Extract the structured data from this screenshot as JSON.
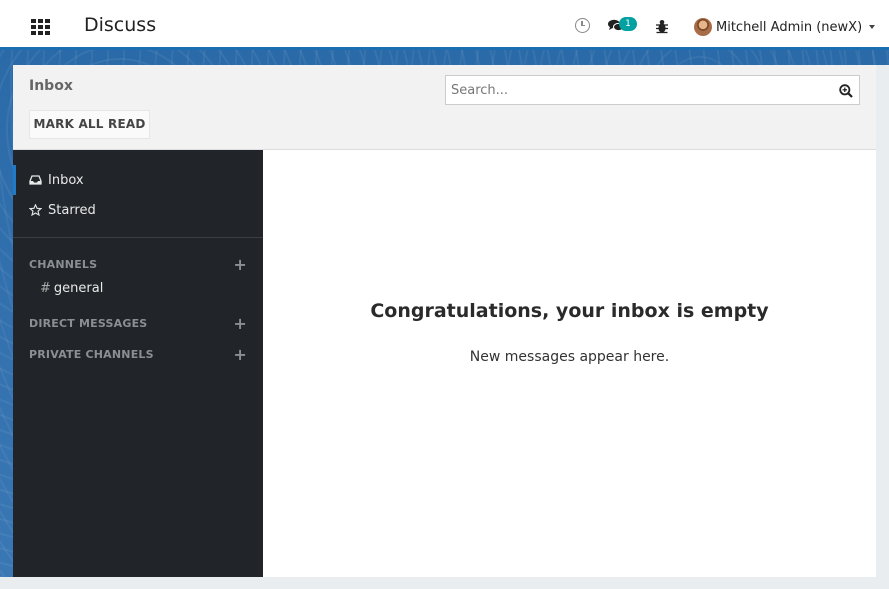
{
  "topbar": {
    "app_title": "Discuss",
    "apps_icon": "apps-grid-icon",
    "activity_icon": "clock-icon",
    "messaging_icon": "chat-icon",
    "messaging_badge": "1",
    "debug_icon": "bug-icon",
    "user_name": "Mitchell Admin (newX)"
  },
  "control_panel": {
    "breadcrumb": "Inbox",
    "mark_all_read": "MARK ALL READ",
    "search_placeholder": "Search..."
  },
  "sidebar": {
    "items": [
      {
        "label": "Inbox",
        "icon": "inbox-icon",
        "active": true
      },
      {
        "label": "Starred",
        "icon": "star-icon",
        "active": false
      }
    ],
    "sections": {
      "channels": "CHANNELS",
      "direct_messages": "DIRECT MESSAGES",
      "private_channels": "PRIVATE CHANNELS"
    },
    "channels": [
      {
        "prefix": "#",
        "name": "general"
      }
    ]
  },
  "main": {
    "empty_title": "Congratulations, your inbox is empty",
    "empty_subtitle": "New messages appear here."
  },
  "colors": {
    "accent": "#1f7ac8",
    "badge": "#01a1a1",
    "sidebar_bg": "#212529"
  }
}
